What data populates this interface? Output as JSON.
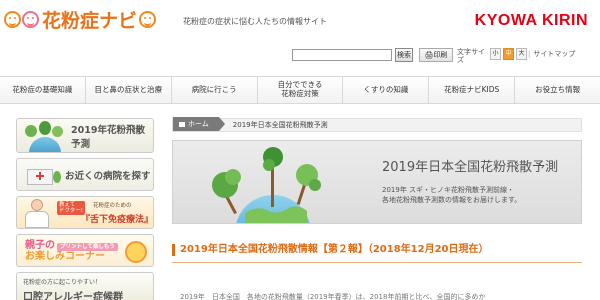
{
  "header": {
    "logo_text": "花粉症ナビ",
    "tagline": "花粉症の症状に悩む人たちの情報サイト",
    "brand": "KYOWA KIRIN"
  },
  "utility": {
    "search_placeholder": "",
    "search_button": "検索",
    "print_button": "印刷",
    "font_size_label": "文字サイズ",
    "font_sizes": [
      "小",
      "中",
      "大"
    ],
    "font_size_selected": "中",
    "sitemap_label": "サイトマップ"
  },
  "nav": {
    "items": [
      "花粉症の基礎知識",
      "目と鼻の症状と治療",
      "病院に行こう",
      "自分でできる\n花粉症対策",
      "くすりの知識",
      "花粉症ナビKIDS",
      "お役立ち情報"
    ]
  },
  "sidebar": {
    "forecast_label": "2019年花粉飛散予測",
    "hospital_label": "お近くの病院を探す",
    "doctor_tag": "教えて\nドクター!",
    "doctor_small": "花粉症のための",
    "doctor_title": "『舌下免疫療法』",
    "fun_title_a": "親子の",
    "fun_title_b": "お楽しみコーナー",
    "fun_tag": "プリントして楽しもう",
    "last_small": "花粉症の方に起こりやすい！",
    "last_big": "口腔アレルギー症候群"
  },
  "breadcrumb": {
    "home": "ホーム",
    "current": "2019年日本全国花粉飛散予測"
  },
  "hero": {
    "title": "2019年日本全国花粉飛散予測",
    "line1": "2019年 スギ・ヒノキ花粉飛散予測前線・",
    "line2": "各地花粉飛散予測数の情報をお届けします。"
  },
  "section": {
    "title": "2019年日本全国花粉飛散情報【第２報】（2018年12月20日現在）",
    "body": "2019年　日本全国　各地の花粉飛散量（2019年春季）は、2018年前期と比べ、全国的に多めか"
  },
  "colors": {
    "accent": "#e26a12",
    "brand": "#e60012",
    "logo": "#e8731a"
  }
}
